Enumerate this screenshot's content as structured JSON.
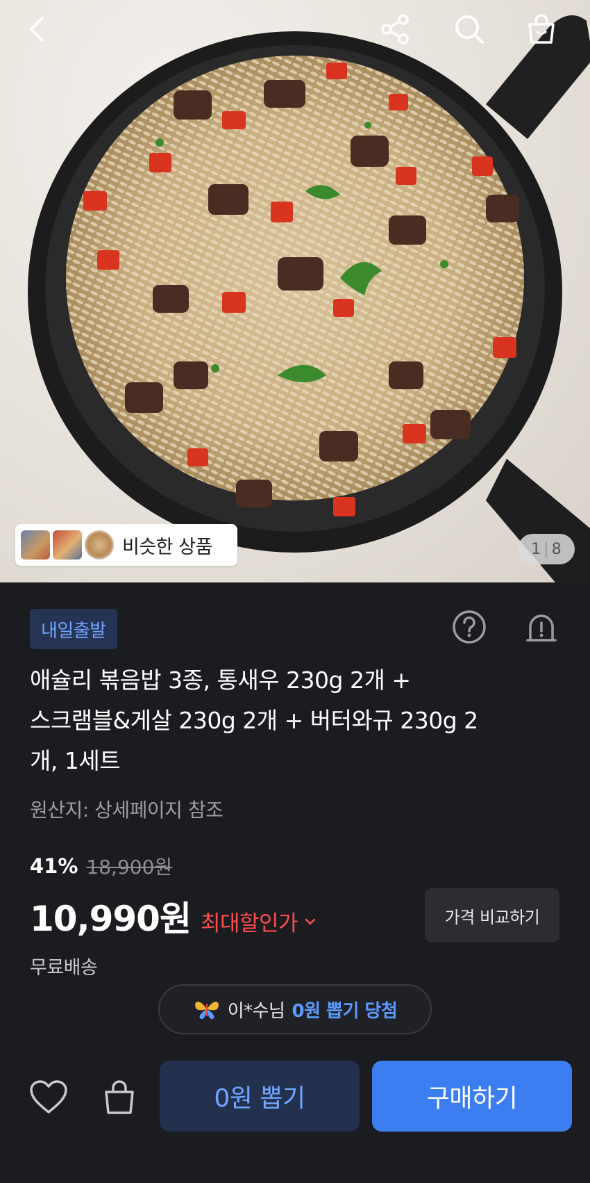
{
  "hero": {
    "similar_label": "비슷한 상품",
    "pager_current": "1",
    "pager_total": "8"
  },
  "topbar": {
    "icons": [
      "back-icon",
      "share-icon",
      "search-icon",
      "shopping-bag-icon"
    ]
  },
  "product": {
    "badge": "내일출발",
    "title_line1": "애슐리 볶음밥 3종, 통새우 230g 2개 +",
    "title_line2": "스크램블&게살 230g 2개 + 버터와규 230g 2",
    "title_line3": "개, 1세트",
    "origin": "원산지: 상세페이지 참조",
    "discount_pct": "41%",
    "original_price": "18,900원",
    "price": "10,990원",
    "max_discount_label": "최대할인가",
    "compare_label": "가격 비교하기",
    "shipping": "무료배송"
  },
  "winner_toast": {
    "name": "이*수님",
    "highlight": "0원 뽑기 당첨"
  },
  "bottom": {
    "draw_label": "0원 뽑기",
    "buy_label": "구매하기"
  },
  "colors": {
    "background": "#1b1c20",
    "accent_blue": "#3d7df2",
    "badge_bg": "#263454",
    "discount_red": "#ff4d4f"
  }
}
